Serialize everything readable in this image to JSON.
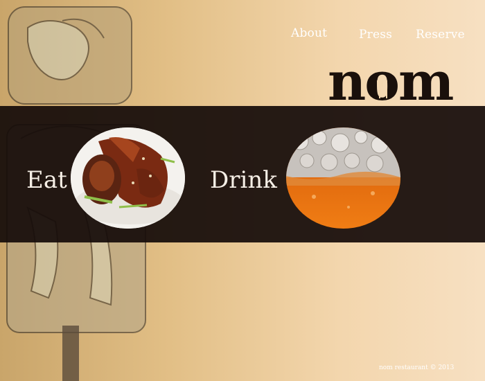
{
  "nav": {
    "about": "About",
    "press": "Press",
    "reserve": "Reserve"
  },
  "brand": {
    "logo_text": "nom",
    "colors": {
      "dark": "#1a100b",
      "band": "#160c0a",
      "nav_text": "#ffffff",
      "background_left": "#c9a56a",
      "background_right": "#f7e0c2"
    }
  },
  "main": {
    "eat_label": "Eat",
    "drink_label": "Drink",
    "eat_image": "chicken-dish-photo",
    "drink_image": "beer-foam-photo"
  },
  "footer": {
    "text": "nom restaurant © 2013"
  }
}
